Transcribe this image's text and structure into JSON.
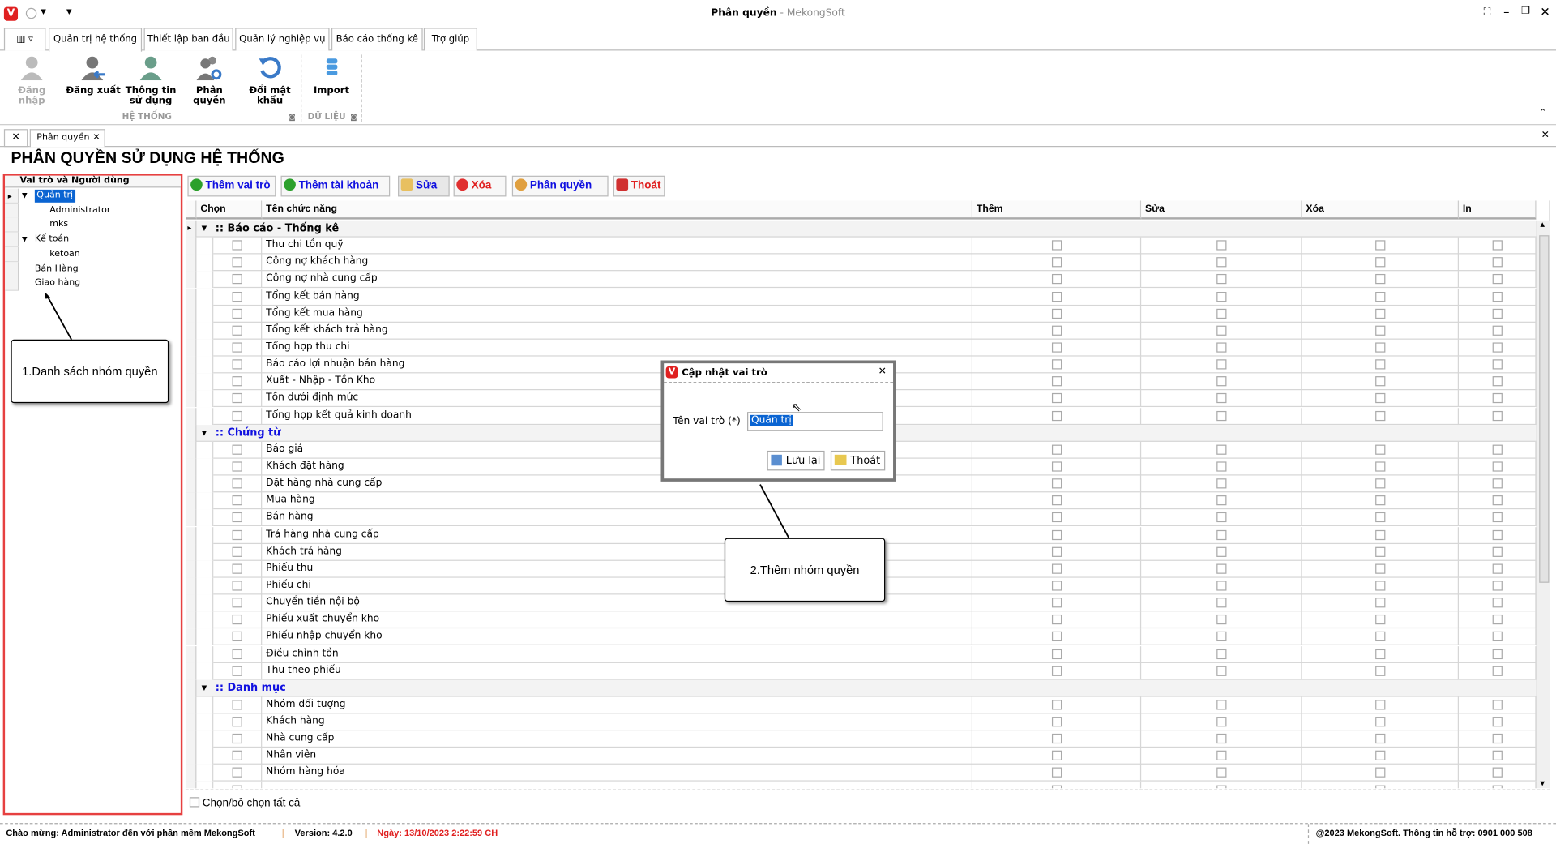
{
  "window": {
    "title": "Phân quyền",
    "subtitle": " - MekongSoft"
  },
  "ribbon_tabs": [
    "Quản trị hệ thống",
    "Thiết lập ban đầu",
    "Quản lý nghiệp vụ",
    "Báo cáo thống kê",
    "Trợ giúp"
  ],
  "ribbon": {
    "buttons": [
      {
        "label": "Đăng nhập",
        "icon": "user-login-icon",
        "disabled": true
      },
      {
        "label": "Đăng xuất",
        "icon": "user-logout-icon"
      },
      {
        "label": "Thông tin sử dụng",
        "icon": "user-info-icon"
      },
      {
        "label": "Phân quyền",
        "icon": "users-gear-icon"
      },
      {
        "label": "Đổi mật khẩu",
        "icon": "refresh-icon"
      },
      {
        "label": "Import",
        "icon": "database-icon"
      }
    ],
    "groups": [
      "HỆ THỐNG",
      "DỮ LIỆU"
    ]
  },
  "doc_tab": "Phân quyền",
  "page_title": "PHÂN QUYỀN SỬ DỤNG HỆ THỐNG",
  "tree": {
    "header": "Vai trò và Người dùng",
    "items": [
      {
        "label": "Quản trị",
        "level": 1,
        "expanded": true,
        "selected": true
      },
      {
        "label": "Administrator",
        "level": 2
      },
      {
        "label": "mks",
        "level": 2
      },
      {
        "label": "Kế toán",
        "level": 1,
        "expanded": true
      },
      {
        "label": "ketoan",
        "level": 2
      },
      {
        "label": "Bán Hàng",
        "level": 1
      },
      {
        "label": "Giao hàng",
        "level": 1
      }
    ]
  },
  "toolbar": {
    "add_role": "Thêm vai trò",
    "add_account": "Thêm tài khoản",
    "edit": "Sửa",
    "delete": "Xóa",
    "permission": "Phân quyền",
    "exit": "Thoát"
  },
  "grid": {
    "columns": [
      "Chọn",
      "Tên chức năng",
      "Thêm",
      "Sửa",
      "Xóa",
      "In"
    ],
    "groups": [
      {
        "title": ":: Báo cáo - Thống kê",
        "items": [
          "Thu chi tồn quỹ",
          "Công nợ khách hàng",
          "Công nợ nhà cung cấp",
          "Tổng kết bán hàng",
          "Tổng kết mua hàng",
          "Tổng kết khách trả hàng",
          "Tổng hợp thu chi",
          "Báo cáo lợi nhuận bán hàng",
          "Xuất - Nhập - Tồn Kho",
          "Tồn dưới định mức",
          "Tổng hợp kết quả kinh doanh"
        ]
      },
      {
        "title": ":: Chứng từ",
        "items": [
          "Báo giá",
          "Khách đặt hàng",
          "Đặt hàng nhà cung cấp",
          "Mua hàng",
          "Bán hàng",
          "Trả hàng nhà cung cấp",
          "Khách trả hàng",
          "Phiếu thu",
          "Phiếu chi",
          "Chuyển tiền nội bộ",
          "Phiếu xuất chuyển kho",
          "Phiếu nhập chuyển kho",
          "Điều chỉnh tồn",
          "Thu theo phiếu"
        ]
      },
      {
        "title": ":: Danh mục",
        "items": [
          "Nhóm đối tượng",
          "Khách hàng",
          "Nhà cung cấp",
          "Nhân viên",
          "Nhóm hàng hóa",
          ""
        ]
      }
    ]
  },
  "select_all": "Chọn/bỏ chọn tất cả",
  "dialog": {
    "title": "Cập nhật vai trò",
    "field_label": "Tên vai trò (*)",
    "field_value": "Quản trị",
    "save": "Lưu lại",
    "exit": "Thoát"
  },
  "callouts": {
    "one": "1.Danh sách nhóm quyền",
    "two": "2.Thêm nhóm quyền"
  },
  "status": {
    "welcome": "Chào mừng: Administrator đến với phần mềm MekongSoft",
    "version": "Version: 4.2.0",
    "date": "Ngày: 13/10/2023 2:22:59 CH",
    "copyright": "@2023 MekongSoft. Thông tin hỗ trợ: 0901 000 508"
  },
  "colors": {
    "accent_blue": "#1010e0",
    "red": "#e02020",
    "selection": "#0a64d2",
    "panel_border": "#e64040"
  }
}
